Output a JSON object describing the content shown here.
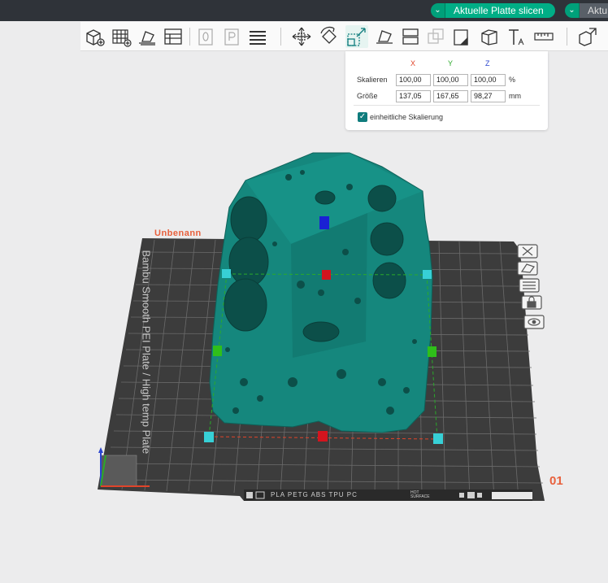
{
  "topbar": {
    "slice_plate_label": "Aktuelle Platte slicen",
    "slice_all_label": "Aktu",
    "dropdown_glyph": "⌄"
  },
  "toolbar": {
    "icons": [
      "add-object-icon",
      "arrange-grid-icon",
      "orient-icon",
      "plates-icon",
      "layer-0-icon",
      "layer-p-icon",
      "list-icon",
      "move-icon",
      "rotate-icon",
      "scale-icon",
      "lay-on-face-icon",
      "cut-icon",
      "boolean-icon",
      "support-paint-icon",
      "seam-paint-icon",
      "text-icon",
      "measure-icon",
      "assembly-icon"
    ]
  },
  "scale_panel": {
    "axis_x": "X",
    "axis_y": "Y",
    "axis_z": "Z",
    "scale_label": "Skalieren",
    "size_label": "Größe",
    "scale_x": "100,00",
    "scale_y": "100,00",
    "scale_z": "100,00",
    "scale_unit": "%",
    "size_x": "137,05",
    "size_y": "167,65",
    "size_z": "98,27",
    "size_unit": "mm",
    "uniform_label": "einheitliche Skalierung",
    "uniform_checked": true,
    "checkmark": "✓"
  },
  "plate": {
    "name": "Unbenann",
    "number": "01",
    "vertical_text": "Bambu Smooth PEI Plate / High temp Plate",
    "strip_text": "PLA PETG ABS TPU PC",
    "hot_label": "HOT",
    "surface_label": "SURFACE"
  },
  "colors": {
    "accent": "#00ae86",
    "model": "#15877d",
    "plate": "#3a3a3a",
    "axis_x": "#e0442a",
    "axis_y": "#2aaa2a",
    "axis_z": "#2a45cf",
    "plate_label": "#e8603c"
  }
}
